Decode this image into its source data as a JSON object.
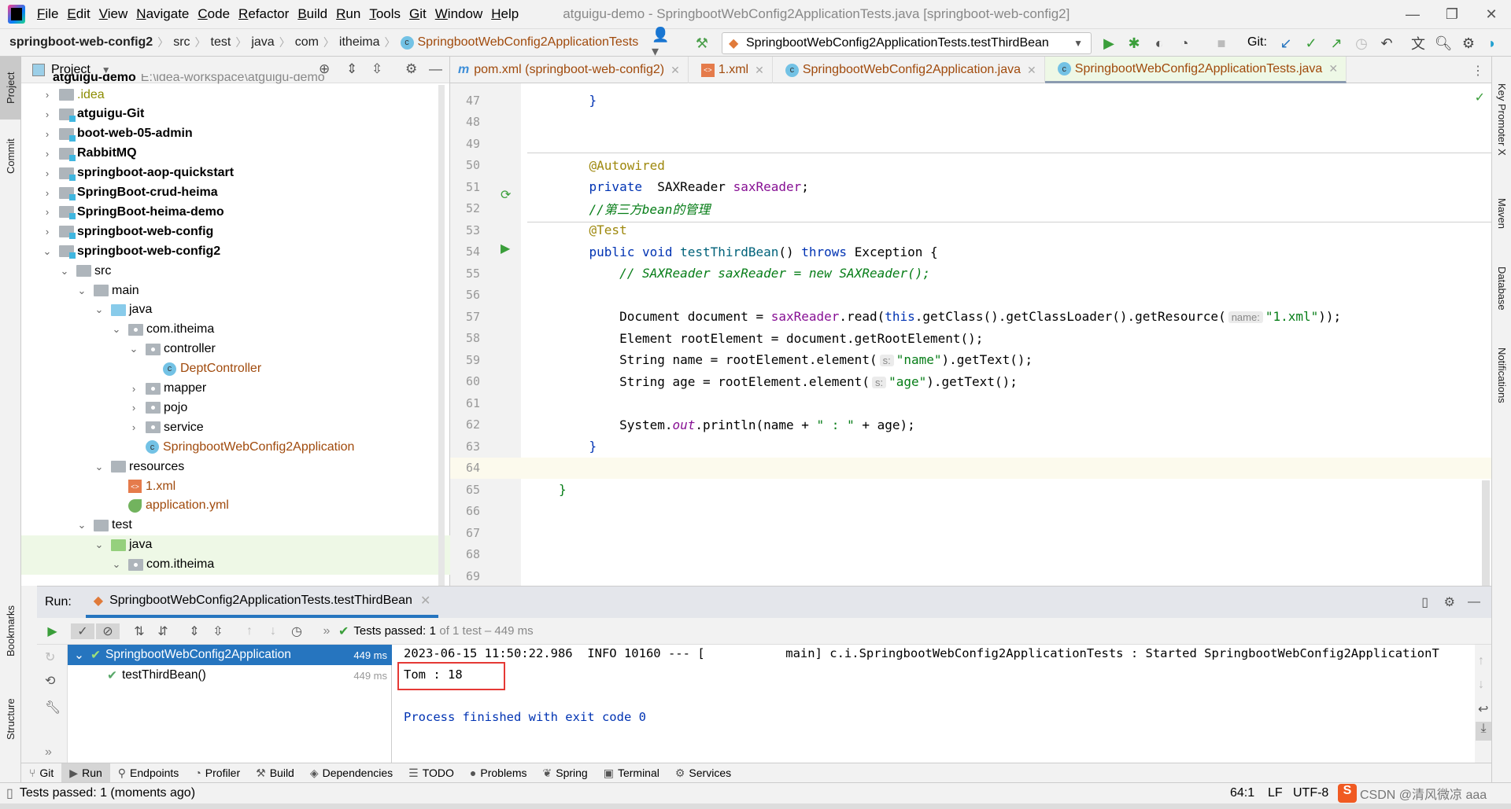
{
  "menubar": {
    "items": [
      "File",
      "Edit",
      "View",
      "Navigate",
      "Code",
      "Refactor",
      "Build",
      "Run",
      "Tools",
      "Git",
      "Window",
      "Help"
    ],
    "title": "atguigu-demo - SpringbootWebConfig2ApplicationTests.java [springboot-web-config2]"
  },
  "navbar": {
    "breadcrumb": [
      "springboot-web-config2",
      "src",
      "test",
      "java",
      "com",
      "itheima",
      "SpringbootWebConfig2ApplicationTests"
    ],
    "run_config": "SpringbootWebConfig2ApplicationTests.testThirdBean",
    "git_label": "Git:"
  },
  "project": {
    "title": "Project",
    "root": "atguigu-demo",
    "root_path": "E:\\idea-workspace\\atguigu-demo",
    "items": [
      {
        "label": ".idea",
        "depth": 1,
        "arrow": "right",
        "icon": "folder",
        "style": "dim"
      },
      {
        "label": "atguigu-Git",
        "depth": 1,
        "arrow": "right",
        "icon": "module",
        "style": "bold"
      },
      {
        "label": "boot-web-05-admin",
        "depth": 1,
        "arrow": "right",
        "icon": "module",
        "style": "bold"
      },
      {
        "label": "RabbitMQ",
        "depth": 1,
        "arrow": "right",
        "icon": "module",
        "style": "bold"
      },
      {
        "label": "springboot-aop-quickstart",
        "depth": 1,
        "arrow": "right",
        "icon": "module",
        "style": "bold"
      },
      {
        "label": "SpringBoot-crud-heima",
        "depth": 1,
        "arrow": "right",
        "icon": "module",
        "style": "bold"
      },
      {
        "label": "SpringBoot-heima-demo",
        "depth": 1,
        "arrow": "right",
        "icon": "module",
        "style": "bold"
      },
      {
        "label": "springboot-web-config",
        "depth": 1,
        "arrow": "right",
        "icon": "module",
        "style": "bold"
      },
      {
        "label": "springboot-web-config2",
        "depth": 1,
        "arrow": "down",
        "icon": "module",
        "style": "bold"
      },
      {
        "label": "src",
        "depth": 2,
        "arrow": "down",
        "icon": "folder",
        "style": ""
      },
      {
        "label": "main",
        "depth": 3,
        "arrow": "down",
        "icon": "folder",
        "style": ""
      },
      {
        "label": "java",
        "depth": 4,
        "arrow": "down",
        "icon": "src",
        "style": ""
      },
      {
        "label": "com.itheima",
        "depth": 5,
        "arrow": "down",
        "icon": "package",
        "style": ""
      },
      {
        "label": "controller",
        "depth": 6,
        "arrow": "down",
        "icon": "package",
        "style": ""
      },
      {
        "label": "DeptController",
        "depth": 7,
        "arrow": "none",
        "icon": "class",
        "style": "brown"
      },
      {
        "label": "mapper",
        "depth": 6,
        "arrow": "right",
        "icon": "package",
        "style": ""
      },
      {
        "label": "pojo",
        "depth": 6,
        "arrow": "right",
        "icon": "package",
        "style": ""
      },
      {
        "label": "service",
        "depth": 6,
        "arrow": "right",
        "icon": "package",
        "style": ""
      },
      {
        "label": "SpringbootWebConfig2Application",
        "depth": 6,
        "arrow": "none",
        "icon": "class",
        "style": "brown"
      },
      {
        "label": "resources",
        "depth": 4,
        "arrow": "down",
        "icon": "folder",
        "style": ""
      },
      {
        "label": "1.xml",
        "depth": 5,
        "arrow": "none",
        "icon": "xml",
        "style": "brown"
      },
      {
        "label": "application.yml",
        "depth": 5,
        "arrow": "none",
        "icon": "yml",
        "style": "brown"
      },
      {
        "label": "test",
        "depth": 3,
        "arrow": "down",
        "icon": "folder",
        "style": ""
      },
      {
        "label": "java",
        "depth": 4,
        "arrow": "down",
        "icon": "test",
        "style": "",
        "selected": true
      },
      {
        "label": "com.itheima",
        "depth": 5,
        "arrow": "down",
        "icon": "package",
        "style": "",
        "selected": true
      }
    ]
  },
  "editor": {
    "tabs": [
      {
        "label": "pom.xml (springboot-web-config2)",
        "icon": "m"
      },
      {
        "label": "1.xml",
        "icon": "xml"
      },
      {
        "label": "SpringbootWebConfig2Application.java",
        "icon": "class"
      },
      {
        "label": "SpringbootWebConfig2ApplicationTests.java",
        "icon": "class",
        "active": true
      }
    ],
    "current_line": 64,
    "lines": [
      {
        "n": 47,
        "tokens": [
          {
            "t": "    "
          },
          {
            "t": "}",
            "c": "k"
          }
        ]
      },
      {
        "n": 48,
        "tokens": []
      },
      {
        "n": 49,
        "tokens": []
      },
      {
        "n": 50,
        "tokens": [
          {
            "t": "    "
          },
          {
            "t": "@Autowired",
            "c": "a"
          }
        ]
      },
      {
        "n": 51,
        "tokens": [
          {
            "t": "    "
          },
          {
            "t": "private",
            "c": "k"
          },
          {
            "t": "  SAXReader "
          },
          {
            "t": "saxReader",
            "c": "f"
          },
          {
            "t": ";"
          }
        ]
      },
      {
        "n": 52,
        "tokens": [
          {
            "t": "    "
          },
          {
            "t": "//第三方bean的管理",
            "c": "cg"
          }
        ]
      },
      {
        "n": 53,
        "tokens": [
          {
            "t": "    "
          },
          {
            "t": "@Test",
            "c": "a"
          }
        ]
      },
      {
        "n": 54,
        "tokens": [
          {
            "t": "    "
          },
          {
            "t": "public void ",
            "c": "k"
          },
          {
            "t": "testThirdBean",
            "c": "m"
          },
          {
            "t": "() "
          },
          {
            "t": "throws ",
            "c": "k"
          },
          {
            "t": "Exception {"
          }
        ]
      },
      {
        "n": 55,
        "tokens": [
          {
            "t": "        "
          },
          {
            "t": "// SAXReader saxReader = new SAXReader();",
            "c": "cg"
          }
        ]
      },
      {
        "n": 56,
        "tokens": []
      },
      {
        "n": 57,
        "tokens": [
          {
            "t": "        Document document = "
          },
          {
            "t": "saxReader",
            "c": "f"
          },
          {
            "t": ".read("
          },
          {
            "t": "this",
            "c": "k"
          },
          {
            "t": ".getClass().getClassLoader().getResource("
          },
          {
            "h": "name:"
          },
          {
            "t": "\"1.xml\"",
            "c": "s"
          },
          {
            "t": "));"
          }
        ]
      },
      {
        "n": 58,
        "tokens": [
          {
            "t": "        Element rootElement = document.getRootElement();"
          }
        ]
      },
      {
        "n": 59,
        "tokens": [
          {
            "t": "        String name = rootElement.element("
          },
          {
            "h": "s:"
          },
          {
            "t": "\"name\"",
            "c": "s"
          },
          {
            "t": ").getText();"
          }
        ]
      },
      {
        "n": 60,
        "tokens": [
          {
            "t": "        String age = rootElement.element("
          },
          {
            "h": "s:"
          },
          {
            "t": "\"age\"",
            "c": "s"
          },
          {
            "t": ").getText();"
          }
        ]
      },
      {
        "n": 61,
        "tokens": []
      },
      {
        "n": 62,
        "tokens": [
          {
            "t": "        System."
          },
          {
            "t": "out",
            "c": "fi"
          },
          {
            "t": ".println(name + "
          },
          {
            "t": "\" : \"",
            "c": "s"
          },
          {
            "t": " + age);"
          }
        ]
      },
      {
        "n": 63,
        "tokens": [
          {
            "t": "    "
          },
          {
            "t": "}",
            "c": "k"
          }
        ]
      },
      {
        "n": 64,
        "tokens": []
      },
      {
        "n": 65,
        "tokens": [
          {
            "t": "}",
            "c": "s"
          }
        ]
      },
      {
        "n": 66,
        "tokens": []
      },
      {
        "n": 67,
        "tokens": []
      },
      {
        "n": 68,
        "tokens": []
      },
      {
        "n": 69,
        "tokens": []
      }
    ]
  },
  "run": {
    "label": "Run:",
    "tab": "SpringbootWebConfig2ApplicationTests.testThirdBean",
    "status_prefix": "Tests passed:",
    "status_count": "1",
    "status_rest": "of 1 test – 449 ms",
    "tree": [
      {
        "label": "SpringbootWebConfig2Application",
        "time": "449 ms",
        "selected": true
      },
      {
        "label": "testThirdBean()",
        "time": "449 ms"
      }
    ],
    "console": [
      "2023-06-15 11:50:22.986  INFO 10160 --- [           main] c.i.SpringbootWebConfig2ApplicationTests : Started SpringbootWebConfig2ApplicationT",
      "Tom : 18",
      "",
      "Process finished with exit code 0"
    ]
  },
  "left_strip": [
    "Project",
    "Commit",
    "Bookmarks",
    "Structure"
  ],
  "right_strip": [
    "Key Promoter X",
    "Maven",
    "Database",
    "Notifications"
  ],
  "toolwindows": [
    "Git",
    "Run",
    "Endpoints",
    "Profiler",
    "Build",
    "Dependencies",
    "TODO",
    "Problems",
    "Spring",
    "Terminal",
    "Services"
  ],
  "statusbar": {
    "message": "Tests passed: 1 (moments ago)",
    "position": "64:1",
    "line_sep": "LF",
    "encoding": "UTF-8",
    "watermark": "CSDN @清风微凉 aaa"
  },
  "colors": {
    "accent": "#2675bf",
    "highlight_box": "#e53935",
    "pass": "#59a869"
  }
}
